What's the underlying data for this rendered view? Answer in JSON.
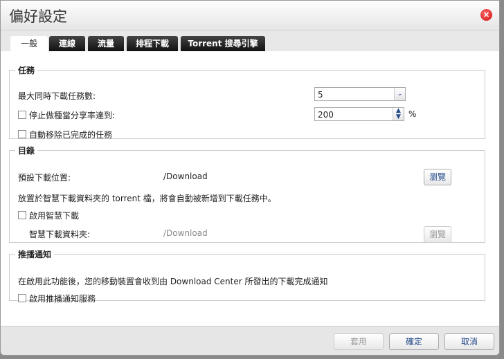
{
  "title": "偏好設定",
  "tabs": [
    "一般",
    "連線",
    "流量",
    "排程下載",
    "Torrent 搜尋引擎"
  ],
  "task": {
    "legend": "任務",
    "max_label": "最大同時下載任務數:",
    "max_value": "5",
    "stop_label": "停止做種當分享率達到:",
    "ratio_value": "200",
    "percent": "%",
    "autoremove_label": "自動移除已完成的任務"
  },
  "dir": {
    "legend": "目錄",
    "default_label": "預設下載位置:",
    "default_path": "/Download",
    "browse": "瀏覽",
    "note": "放置於智慧下載資料夾的 torrent 檔，將會自動被新增到下載任務中。",
    "smart_enable": "啟用智慧下載",
    "smart_label": "智慧下載資料夾:",
    "smart_path": "/Download",
    "browse2": "瀏覽"
  },
  "push": {
    "legend": "推播通知",
    "note": "在啟用此功能後，您的移動裝置會收到由 Download Center 所發出的下載完成通知",
    "enable": "啟用推播通知服務"
  },
  "footer": {
    "apply": "套用",
    "ok": "確定",
    "cancel": "取消"
  }
}
